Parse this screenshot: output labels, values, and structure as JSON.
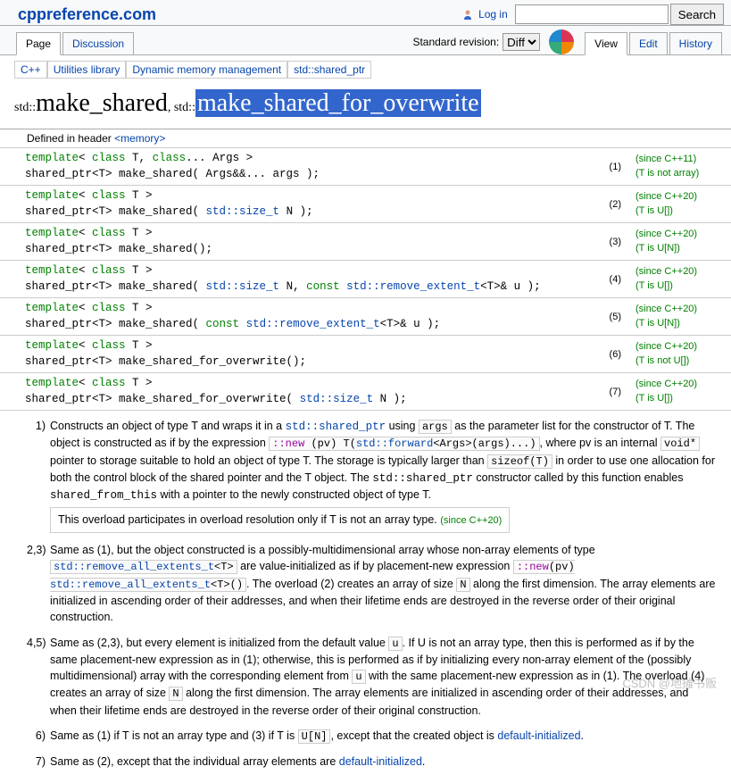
{
  "site": {
    "title": "cppreference.com",
    "login": "Log in",
    "search_btn": "Search"
  },
  "tabs": {
    "page": "Page",
    "discussion": "Discussion",
    "view": "View",
    "edit": "Edit",
    "history": "History"
  },
  "rev": {
    "label": "Standard revision:",
    "value": "Diff"
  },
  "crumbs": {
    "a": "C++",
    "b": "Utilities library",
    "c": "Dynamic memory management",
    "d": "std::shared_ptr"
  },
  "title": {
    "std1": "std::",
    "fn1": "make_shared",
    "sep": ", ",
    "std2": "std::",
    "fn2": "make_shared_for_overwrite"
  },
  "defhead": {
    "label": "Defined in header ",
    "hdr": "<memory>"
  },
  "decls": [
    {
      "line1": "template< class T, class... Args >",
      "line2": "shared_ptr<T> make_shared( Args&&... args );",
      "num": "(1)",
      "note1": "(since C++11)",
      "note2": "(T is not array)"
    },
    {
      "line1": "template< class T >",
      "line2": "shared_ptr<T> make_shared( std::size_t N );",
      "num": "(2)",
      "note1": "(since C++20)",
      "note2": "(T is U[])"
    },
    {
      "line1": "template< class T >",
      "line2": "shared_ptr<T> make_shared();",
      "num": "(3)",
      "note1": "(since C++20)",
      "note2": "(T is U[N])"
    },
    {
      "line1": "template< class T >",
      "line2": "shared_ptr<T> make_shared( std::size_t N, const std::remove_extent_t<T>& u );",
      "num": "(4)",
      "note1": "(since C++20)",
      "note2": "(T is U[])"
    },
    {
      "line1": "template< class T >",
      "line2": "shared_ptr<T> make_shared( const std::remove_extent_t<T>& u );",
      "num": "(5)",
      "note1": "(since C++20)",
      "note2": "(T is U[N])"
    },
    {
      "line1": "template< class T >",
      "line2": "shared_ptr<T> make_shared_for_overwrite();",
      "num": "(6)",
      "note1": "(since C++20)",
      "note2": "(T is not U[])"
    },
    {
      "line1": "template< class T >",
      "line2": "shared_ptr<T> make_shared_for_overwrite( std::size_t N );",
      "num": "(7)",
      "note1": "(since C++20)",
      "note2": "(T is U[])"
    }
  ],
  "desc": {
    "n1": "1)",
    "p1a": "Constructs an object of type T and wraps it in a ",
    "p1b": "std::shared_ptr",
    "p1c": " using ",
    "p1d": "args",
    "p1e": " as the parameter list for the constructor of T. The object is constructed as if by the expression ",
    "p1f": "::new (pv) T(std::forward<Args>(args)...)",
    "p1g": ", where pv is an internal ",
    "p1h": "void*",
    "p1i": " pointer to storage suitable to hold an object of type T. The storage is typically larger than ",
    "p1j": "sizeof(T)",
    "p1k": " in order to use one allocation for both the control block of the shared pointer and the T object. The ",
    "p1l": "std::shared_ptr",
    "p1m": " constructor called by this function enables ",
    "p1n": "shared_from_this",
    "p1o": " with a pointer to the newly constructed object of type T.",
    "p1box": "This overload participates in overload resolution only if T is not an array type. ",
    "p1boxnote": "(since C++20)",
    "n2": "2,3)",
    "p2a": "Same as (1), but the object constructed is a possibly-multidimensional array whose non-array elements of type ",
    "p2b": "std::remove_all_extents_t<T>",
    "p2c": " are value-initialized as if by placement-new expression ",
    "p2d": "::new(pv) std::remove_all_extents_t<T>()",
    "p2e": ". The overload (2) creates an array of size ",
    "p2f": "N",
    "p2g": " along the first dimension. The array elements are initialized in ascending order of their addresses, and when their lifetime ends are destroyed in the reverse order of their original construction.",
    "n4": "4,5)",
    "p4a": "Same as (2,3), but every element is initialized from the default value ",
    "p4b": "u",
    "p4c": ". If U is not an array type, then this is performed as if by the same placement-new expression as in (1); otherwise, this is performed as if by initializing every non-array element of the (possibly multidimensional) array with the corresponding element from ",
    "p4d": "u",
    "p4e": " with the same placement-new expression as in (1). The overload (4) creates an array of size ",
    "p4f": "N",
    "p4g": " along the first dimension. The array elements are initialized in ascending order of their addresses, and when their lifetime ends are destroyed in the reverse order of their original construction.",
    "n6": "6)",
    "p6a": "Same as (1) if T is not an array type and (3) if T is ",
    "p6b": "U[N]",
    "p6c": ", except that the created object is ",
    "p6d": "default-initialized",
    "p6e": ".",
    "n7": "7)",
    "p7a": "Same as (2), except that the individual array elements are ",
    "p7b": "default-initialized",
    "p7c": "."
  },
  "watermark": "CSDN @地摊书贩"
}
